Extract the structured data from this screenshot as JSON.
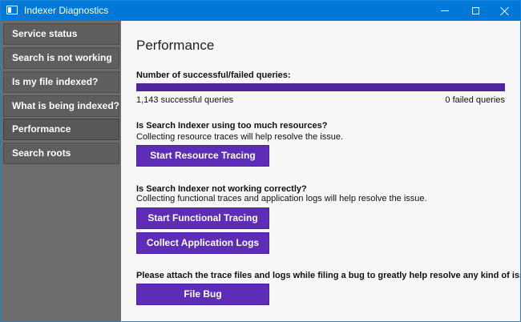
{
  "window": {
    "title": "Indexer Diagnostics",
    "icons": {
      "app": "app-window-icon",
      "minimize": "minimize-icon",
      "maximize": "maximize-icon",
      "close": "close-icon"
    }
  },
  "sidebar": {
    "items": [
      {
        "label": "Service status"
      },
      {
        "label": "Search is not working"
      },
      {
        "label": "Is my file indexed?"
      },
      {
        "label": "What is being indexed?"
      },
      {
        "label": "Performance",
        "selected": true
      },
      {
        "label": "Search roots"
      }
    ]
  },
  "performance": {
    "title": "Performance",
    "queries_heading": "Number of successful/failed queries:",
    "successful_text": "1,143 successful queries",
    "failed_text": "0 failed queries",
    "successful_fraction": 1.0,
    "resources_question": "Is Search Indexer using too much resources?",
    "resources_hint": "Collecting resource traces will help resolve the issue.",
    "resource_button": "Start Resource Tracing",
    "working_question": "Is Search Indexer not working correctly?",
    "working_hint": "Collecting functional traces and application logs will help resolve the issue.",
    "functional_button": "Start Functional Tracing",
    "logs_button": "Collect Application Logs",
    "bug_hint": "Please attach the trace files and logs while filing a bug to greatly help resolve any kind of issue.",
    "bug_button": "File Bug"
  },
  "colors": {
    "title_bar": "#0078d7",
    "sidebar": "#6d6d6d",
    "accent_purple": "#5d2db8",
    "progress": "#5126a0"
  }
}
